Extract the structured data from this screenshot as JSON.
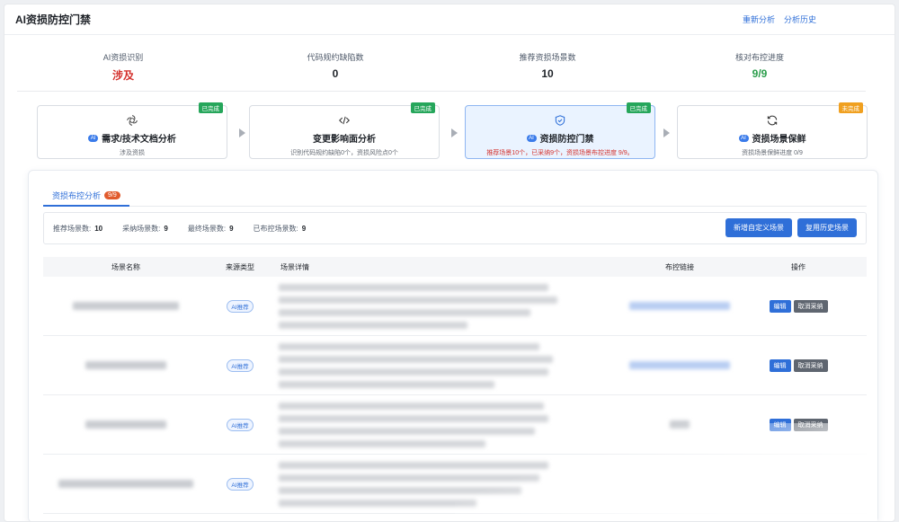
{
  "header": {
    "title": "AI资损防控门禁",
    "links": [
      "重新分析",
      "分析历史"
    ]
  },
  "stats": [
    {
      "label": "AI资损识别",
      "value": "涉及",
      "color": "#d4312d"
    },
    {
      "label": "代码规约缺陷数",
      "value": "0",
      "color": "#1f2329"
    },
    {
      "label": "推荐资损场景数",
      "value": "10",
      "color": "#1f2329"
    },
    {
      "label": "核对布控进度",
      "value": "9/9",
      "color": "#2a9d4b"
    }
  ],
  "steps": [
    {
      "name": "需求/技术文档分析",
      "desc": "涉及资损",
      "tag": "已完成",
      "tag_type": "done",
      "ai": "AI",
      "icon": "openai-icon"
    },
    {
      "name": "变更影响面分析",
      "desc": "识别代码规约缺陷0个，资损风险点0个",
      "tag": "已完成",
      "tag_type": "done",
      "ai": "",
      "icon": "code-icon"
    },
    {
      "name": "资损防控门禁",
      "desc": "推荐场景10个，已采纳9个，资损场景布控进度 9/9。",
      "tag": "已完成",
      "tag_type": "done",
      "ai": "AI",
      "icon": "shield-check-icon"
    },
    {
      "name": "资损场景保鲜",
      "desc": "资损场景保鲜进度 0/9",
      "tag": "未完成",
      "tag_type": "todo",
      "ai": "AI",
      "icon": "refresh-icon"
    }
  ],
  "panel": {
    "tab_label": "资损布控分析",
    "tab_count": "9/9",
    "summary": [
      {
        "label": "推荐场景数:",
        "value": "10"
      },
      {
        "label": "采纳场景数:",
        "value": "9"
      },
      {
        "label": "最终场景数:",
        "value": "9"
      },
      {
        "label": "已布控场景数:",
        "value": "9"
      }
    ],
    "buttons": {
      "add": "新增自定义场景",
      "reuse": "复用历史场景"
    }
  },
  "table": {
    "columns": [
      "场景名称",
      "来源类型",
      "场景详情",
      "布控链接",
      "操作"
    ],
    "rows": [
      {
        "source": "AI推荐",
        "edit": "编辑",
        "cancel": "取消采纳"
      },
      {
        "source": "AI推荐",
        "edit": "编辑",
        "cancel": "取消采纳"
      },
      {
        "source": "AI推荐",
        "edit": "编辑",
        "cancel": "取消采纳"
      },
      {
        "source": "AI推荐",
        "edit": "",
        "cancel": ""
      }
    ]
  },
  "colors": {
    "accent": "#2f6fd8",
    "danger": "#d4312d",
    "success": "#2a9d4b",
    "warning": "#f0a020"
  }
}
